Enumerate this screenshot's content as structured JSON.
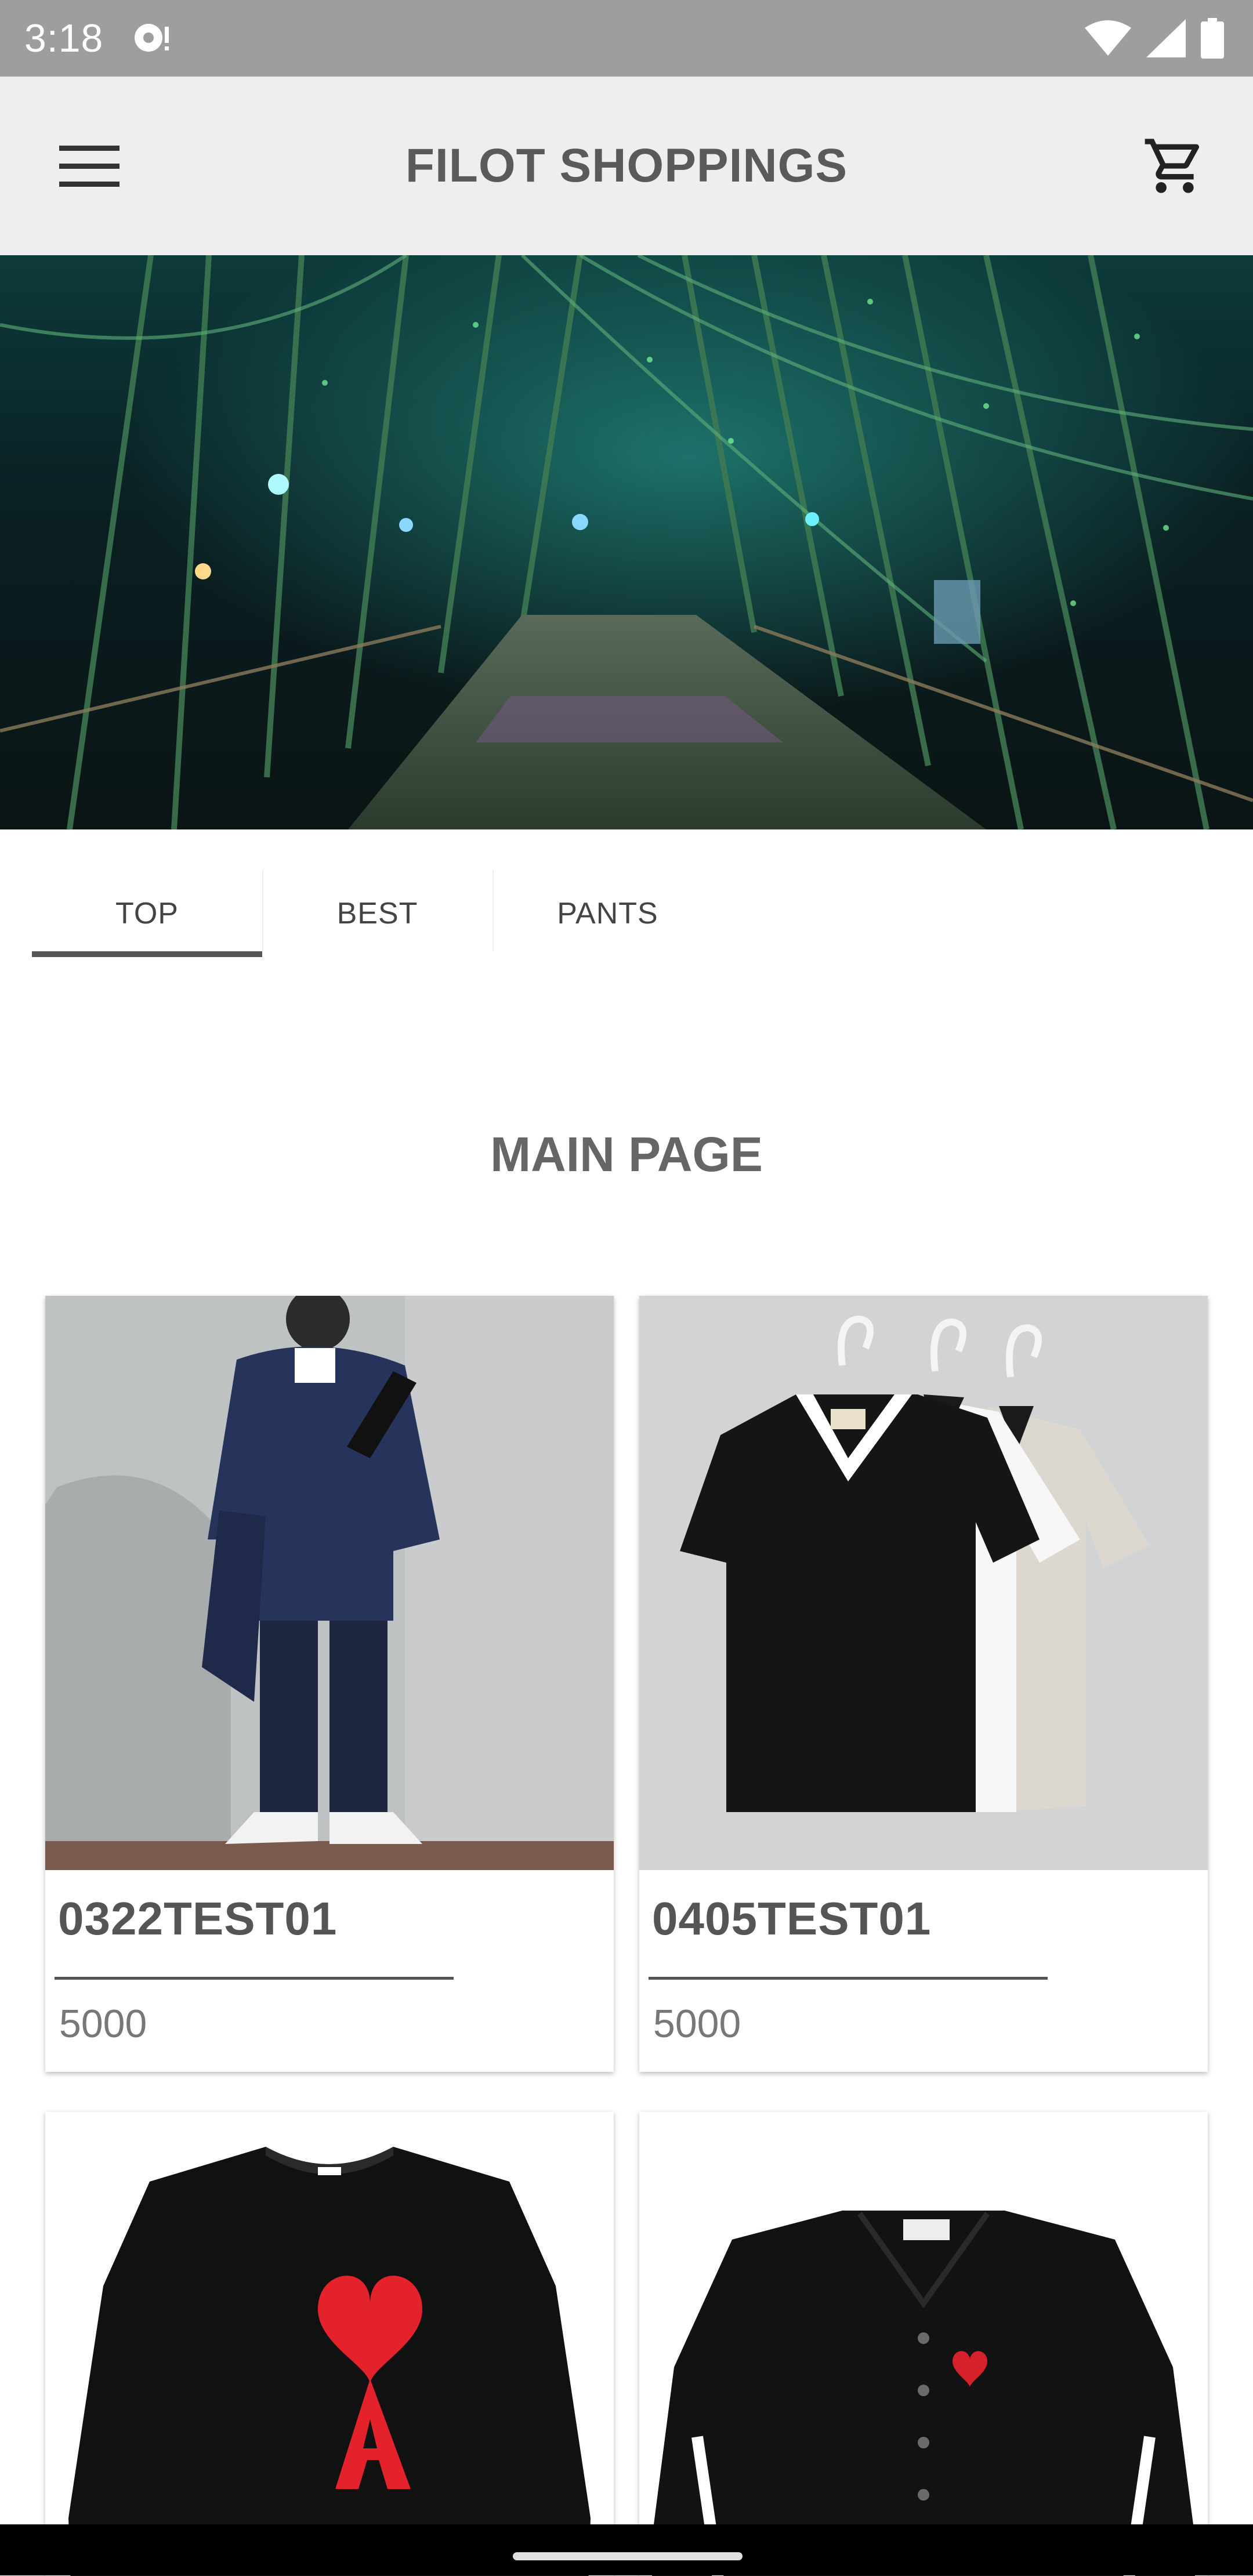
{
  "status_bar": {
    "time": "3:18",
    "icons": [
      "notification-icon",
      "wifi-icon",
      "cell-signal-icon",
      "battery-icon"
    ]
  },
  "app_bar": {
    "title": "FILOT SHOPPINGS",
    "menu_icon": "hamburger-menu-icon",
    "cart_icon": "shopping-cart-icon"
  },
  "banner": {
    "image": "night bamboo forest path with colored lights"
  },
  "tabs": [
    {
      "label": "TOP",
      "active": true
    },
    {
      "label": "BEST",
      "active": false
    },
    {
      "label": "PANTS",
      "active": false
    }
  ],
  "main": {
    "heading": "MAIN PAGE",
    "products": [
      {
        "name": "0322TEST01",
        "price": "5000",
        "image": "man in navy knit outfit against concrete wall"
      },
      {
        "name": "0405TEST01",
        "price": "5000",
        "image": "three v-neck t-shirts on hangers"
      },
      {
        "name": "",
        "price": "",
        "image": "black sweater with red heart logo"
      },
      {
        "name": "",
        "price": "",
        "image": "black cardigan with heart patch"
      }
    ]
  },
  "colors": {
    "status_bar": "#9e9e9e",
    "app_bar": "#eeeeee",
    "title_text": "#5a5a5a",
    "tab_indicator": "#555555"
  }
}
